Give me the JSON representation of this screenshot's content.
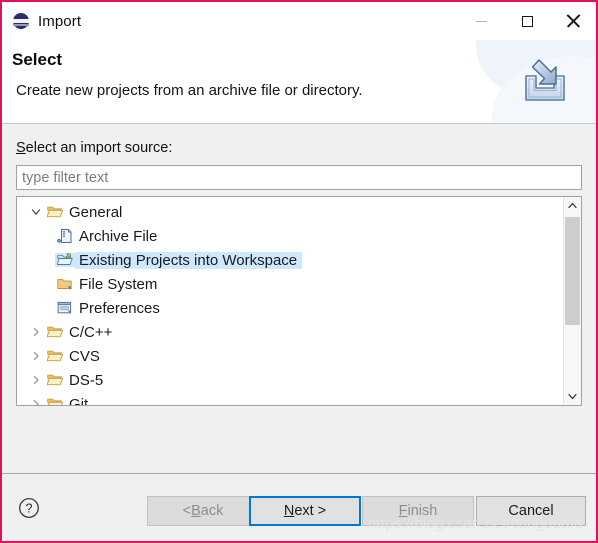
{
  "window": {
    "title": "Import",
    "icon": "eclipse-globe-icon",
    "controls": {
      "minimize": "minimize-icon",
      "maximize": "maximize-icon",
      "close": "close-icon"
    }
  },
  "banner": {
    "title": "Select",
    "description": "Create new projects from an archive file or directory.",
    "icon": "import-tray-icon"
  },
  "form": {
    "source_label_mnemonic": "S",
    "source_label_rest": "elect an import source:",
    "filter": {
      "value": "",
      "placeholder": "type filter text"
    }
  },
  "tree": {
    "items": [
      {
        "label": "General",
        "level": 0,
        "state": "expanded",
        "icon": "folder-open-icon",
        "selected": false
      },
      {
        "label": "Archive File",
        "level": 1,
        "state": "leaf",
        "icon": "archive-file-icon",
        "selected": false
      },
      {
        "label": "Existing Projects into Workspace",
        "level": 1,
        "state": "leaf",
        "icon": "projects-import-icon",
        "selected": true
      },
      {
        "label": "File System",
        "level": 1,
        "state": "leaf",
        "icon": "folder-closed-icon",
        "selected": false
      },
      {
        "label": "Preferences",
        "level": 1,
        "state": "leaf",
        "icon": "preferences-icon",
        "selected": false
      },
      {
        "label": "C/C++",
        "level": 0,
        "state": "collapsed",
        "icon": "folder-open-icon",
        "selected": false
      },
      {
        "label": "CVS",
        "level": 0,
        "state": "collapsed",
        "icon": "folder-open-icon",
        "selected": false
      },
      {
        "label": "DS-5",
        "level": 0,
        "state": "collapsed",
        "icon": "folder-open-icon",
        "selected": false
      },
      {
        "label": "Git",
        "level": 0,
        "state": "collapsed",
        "icon": "folder-open-icon",
        "selected": false
      }
    ],
    "scrollbar": {
      "up_arrow": "chevron-up-icon",
      "down_arrow": "chevron-down-icon"
    }
  },
  "footer": {
    "help": "help-icon",
    "buttons": {
      "back": {
        "prefix": "< ",
        "mnemonic": "B",
        "suffix": "ack",
        "enabled": false,
        "default": false
      },
      "next": {
        "prefix": "",
        "mnemonic": "N",
        "suffix": "ext >",
        "enabled": true,
        "default": true
      },
      "finish": {
        "prefix": "",
        "mnemonic": "F",
        "suffix": "inish",
        "enabled": false,
        "default": false
      },
      "cancel": {
        "prefix": "",
        "mnemonic": "",
        "suffix": "Cancel",
        "enabled": true,
        "default": false
      }
    }
  },
  "watermark": "https://blog.csdn.net/cungudafa",
  "colors": {
    "dialog_border": "#e0115f",
    "selection": "#cde8ff",
    "focus_ring": "#0078d7",
    "body_bg": "#f0f0f0"
  }
}
